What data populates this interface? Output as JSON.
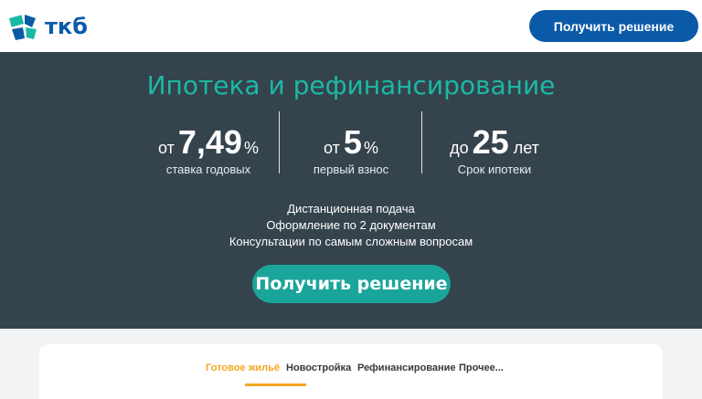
{
  "header": {
    "logo_text": "ткб",
    "cta_label": "Получить решение"
  },
  "hero": {
    "title": "Ипотека и рефинансирование",
    "stats": [
      {
        "prefix": "от",
        "value": "7,49",
        "suffix": "%",
        "caption": "ставка годовых"
      },
      {
        "prefix": "от",
        "value": "5",
        "suffix": "%",
        "caption": "первый взнос"
      },
      {
        "prefix": "до",
        "value": "25",
        "suffix": "лет",
        "caption": "Срок ипотеки"
      }
    ],
    "features": [
      "Дистанционная подача",
      "Оформление по 2 документам",
      "Консультации по самым сложным вопросам"
    ],
    "cta_label": "Получить решение"
  },
  "tabs": [
    {
      "label": "Готовое жильё",
      "active": true
    },
    {
      "label": "Новостройка",
      "active": false
    },
    {
      "label": "Рефинансирование",
      "active": false
    },
    {
      "label": "Прочее...",
      "active": false
    }
  ],
  "colors": {
    "brand_blue": "#0b5aa8",
    "hero_bg": "#35434d",
    "teal": "#1aa59b",
    "active_tab": "#f5a623"
  }
}
